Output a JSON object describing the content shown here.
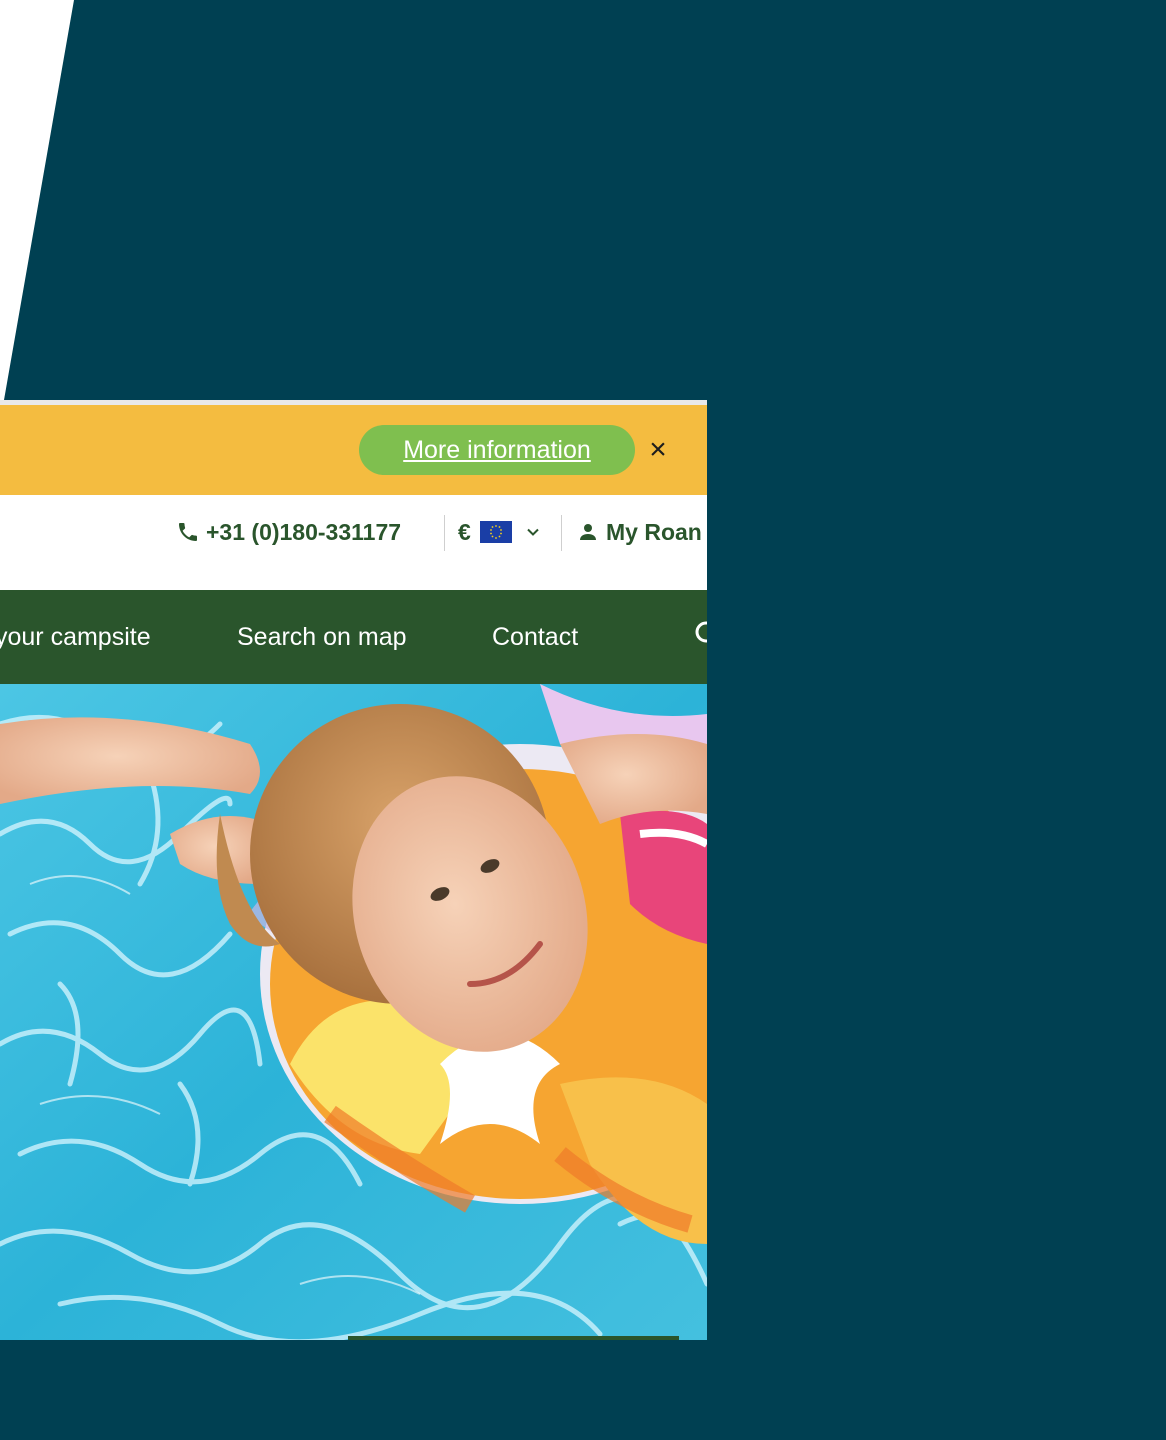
{
  "notice": {
    "more_info_label": "More information",
    "close_label": "×"
  },
  "utility": {
    "phone": "+31 (0)180-331177",
    "currency_symbol": "€",
    "account_label": "My Roan"
  },
  "nav": {
    "items": [
      {
        "label": "your campsite"
      },
      {
        "label": "Search on map"
      },
      {
        "label": "Contact"
      }
    ]
  },
  "icons": {
    "phone": "phone-icon",
    "flag": "eu-flag-icon",
    "dropdown": "chevron-down-icon",
    "account": "user-icon",
    "search": "search-icon",
    "close": "close-icon"
  },
  "colors": {
    "page_background": "#004052",
    "notice_bar": "#f4bc40",
    "notice_button": "#7fbf4f",
    "brand_green": "#2a552c",
    "pool_water": "#33b9da"
  }
}
